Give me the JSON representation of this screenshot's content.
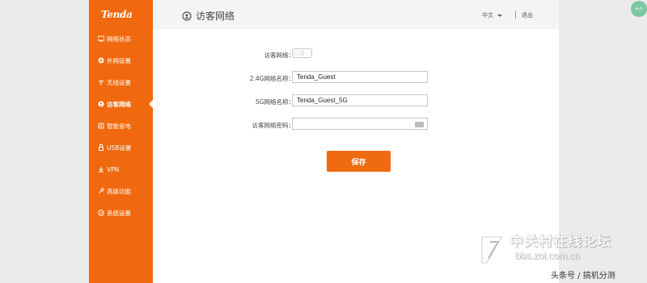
{
  "brand": {
    "logo": "Tenda",
    "accent": "#f1690e"
  },
  "sidebar": {
    "items": [
      {
        "label": "网络状态",
        "icon": "network-status-icon",
        "active": false
      },
      {
        "label": "外网设置",
        "icon": "globe-icon",
        "active": false
      },
      {
        "label": "无线设置",
        "icon": "wifi-icon",
        "active": false
      },
      {
        "label": "访客网络",
        "icon": "guest-network-icon",
        "active": true
      },
      {
        "label": "智能省电",
        "icon": "power-save-icon",
        "active": false
      },
      {
        "label": "USB设置",
        "icon": "usb-icon",
        "active": false
      },
      {
        "label": "VPN",
        "icon": "vpn-icon",
        "active": false
      },
      {
        "label": "高级功能",
        "icon": "wrench-icon",
        "active": false
      },
      {
        "label": "系统设置",
        "icon": "settings-icon",
        "active": false
      }
    ]
  },
  "header": {
    "title": "访客网络",
    "icon": "guest-network-icon",
    "language": "中文",
    "logout": "退出"
  },
  "form": {
    "guest_toggle": {
      "label": "访客网络：",
      "enabled": false
    },
    "ssid_24": {
      "label": "2.4G网络名称：",
      "value": "Tenda_Guest"
    },
    "ssid_5": {
      "label": "5G网络名称：",
      "value": "Tenda_Guest_5G"
    },
    "password": {
      "label": "访客网络密码：",
      "value": "",
      "icon": "keyboard-icon"
    },
    "save_label": "保存"
  },
  "watermark": {
    "title": "中关村在线论坛",
    "url": "bbs.zol.com.cn",
    "credit": "头条号 / 搞机分测"
  }
}
